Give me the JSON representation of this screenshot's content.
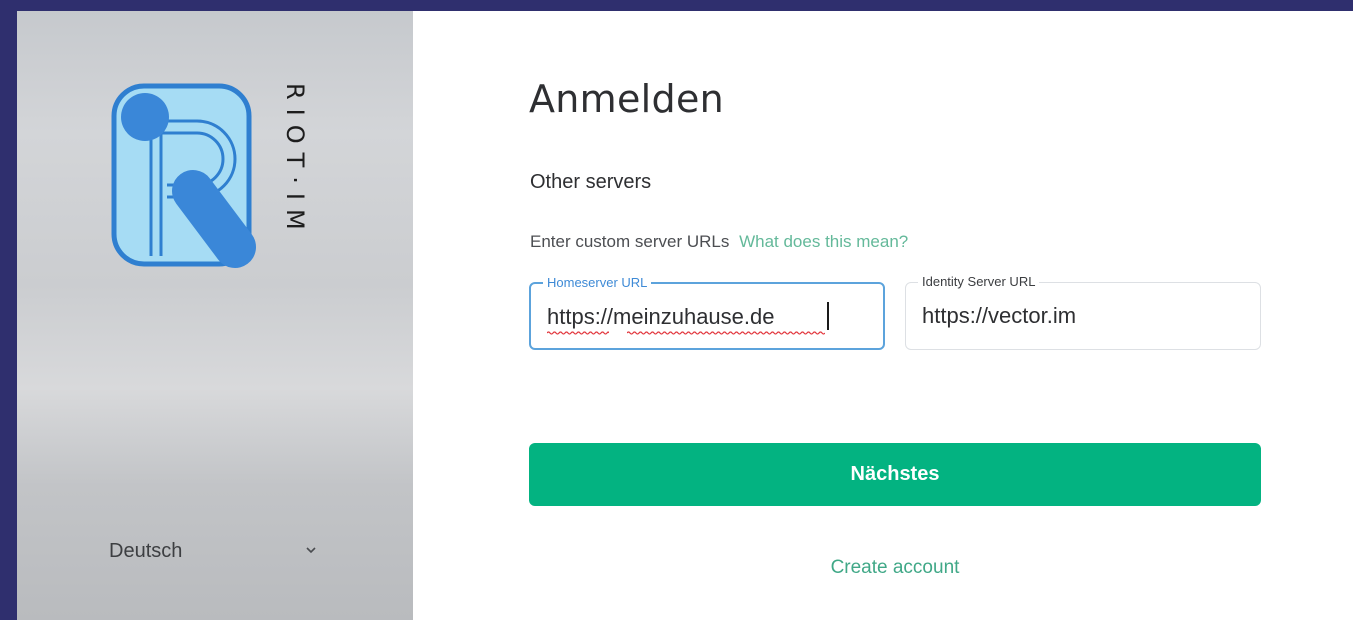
{
  "sidebar": {
    "brand_wordmark": "RIOT·IM",
    "language": {
      "selected": "Deutsch"
    }
  },
  "login": {
    "title": "Anmelden",
    "server_section_title": "Other servers",
    "custom_server_hint": "Enter custom server URLs",
    "help_link": "What does this mean?",
    "homeserver": {
      "label": "Homeserver URL",
      "value": "https://meinzuhause.de"
    },
    "identity_server": {
      "label": "Identity Server URL",
      "value": "https://vector.im"
    },
    "next_button": "Nächstes",
    "create_account_link": "Create account"
  },
  "colors": {
    "outer_background": "#2f2f6e",
    "primary_button": "#03b381",
    "link": "#64b99a",
    "focus_border": "#5ca3dc",
    "logo_light_blue": "#a6dcf4",
    "logo_blue": "#3a87d8"
  }
}
